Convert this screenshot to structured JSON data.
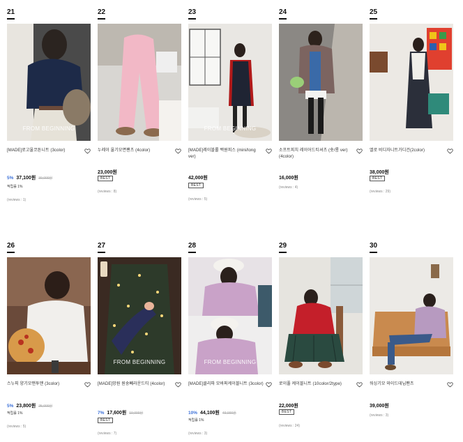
{
  "products": [
    {
      "rank": "21",
      "name": "[MADE]로고울코튼니트 (3color)",
      "discount": "5%",
      "price": "37,100원",
      "orig": "39,000원",
      "badge": "",
      "rec": "적립률 1%",
      "reviews": "(reviews : 1)",
      "watermark": "FROM BEGINNING"
    },
    {
      "rank": "22",
      "name": "누레이 울기모면팬츠 (4color)",
      "discount": "",
      "price": "23,000원",
      "orig": "",
      "badge": "BEST",
      "rec": "",
      "reviews": "(reviews : 8)",
      "watermark": ""
    },
    {
      "rank": "23",
      "name": "[MADE]레이블롤 백원피스 (mini/long ver)",
      "discount": "",
      "price": "42,000원",
      "orig": "",
      "badge": "BEST",
      "rec": "",
      "reviews": "(reviews : 5)",
      "watermark": "FROM BEGINNING"
    },
    {
      "rank": "24",
      "name": "소프트피치 레이어드티셔츠 (숏/롱 ver)(4color)",
      "discount": "",
      "price": "16,000원",
      "orig": "",
      "badge": "",
      "rec": "",
      "reviews": "(reviews : 4)",
      "watermark": ""
    },
    {
      "rank": "25",
      "name": "엘로 비디자니트가디건(2color)",
      "discount": "",
      "price": "38,000원",
      "orig": "",
      "badge": "BEST",
      "rec": "",
      "reviews": "(reviews : 29)",
      "watermark": ""
    },
    {
      "rank": "26",
      "name": "스누피 양기모맨투맨 (3color)",
      "discount": "5%",
      "price": "23,800원",
      "orig": "25,000원",
      "badge": "",
      "rec": "적립률 1%",
      "reviews": "(reviews : 5)",
      "watermark": ""
    },
    {
      "rank": "27",
      "name": "[MADE]망원 원숭빼라운드티 (4color)",
      "discount": "7%",
      "price": "17,600원",
      "orig": "19,000원",
      "badge": "BEST",
      "rec": "",
      "reviews": "(reviews : 7)",
      "watermark": "FROM BEGINNING"
    },
    {
      "rank": "28",
      "name": "[MADE]클리파 모바퍼케이블니트 (3color)",
      "discount": "10%",
      "price": "44,100원",
      "orig": "49,000원",
      "badge": "",
      "rec": "적립률 1%",
      "reviews": "(reviews : 3)",
      "watermark": "FROM BEGINNING"
    },
    {
      "rank": "29",
      "name": "로이풀 케이블니트 (10color/2type)",
      "discount": "",
      "price": "22,000원",
      "orig": "",
      "badge": "BEST",
      "rec": "",
      "reviews": "(reviews : 24)",
      "watermark": ""
    },
    {
      "rank": "30",
      "name": "워싱기모 와이드데님팬츠",
      "discount": "",
      "price": "39,000원",
      "orig": "",
      "badge": "",
      "rec": "",
      "reviews": "(reviews : 3)",
      "watermark": ""
    }
  ],
  "colors": {
    "discount": "#3a6fd8",
    "text": "#222222",
    "muted": "#888888"
  },
  "icons": {
    "wishlist": "heart-outline-icon"
  }
}
